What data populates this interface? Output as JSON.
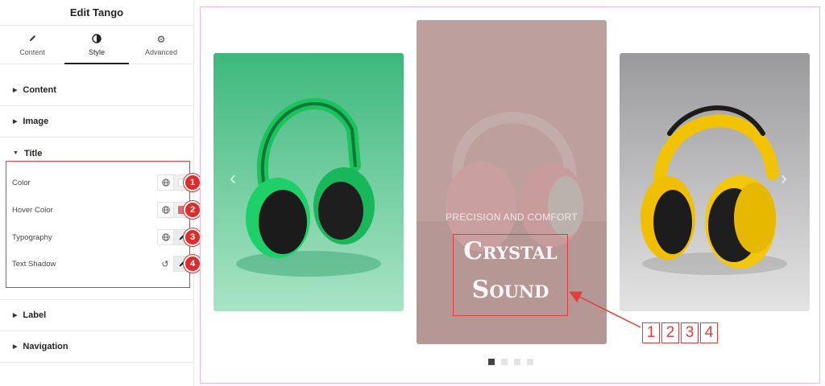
{
  "panel": {
    "title": "Edit Tango",
    "tabs": [
      {
        "label": "Content",
        "icon": "pencil-icon",
        "active": false
      },
      {
        "label": "Style",
        "icon": "contrast-icon",
        "active": true
      },
      {
        "label": "Advanced",
        "icon": "gear-icon",
        "active": false
      }
    ],
    "sections": {
      "content": "Content",
      "image": "Image",
      "title": "Title",
      "label": "Label",
      "navigation": "Navigation"
    },
    "controls": [
      {
        "label": "Color",
        "badge": "1",
        "swatch": "#ffffff"
      },
      {
        "label": "Hover Color",
        "badge": "2",
        "swatch": "#e26a6a"
      },
      {
        "label": "Typography",
        "badge": "3"
      },
      {
        "label": "Text Shadow",
        "badge": "4"
      }
    ]
  },
  "preview": {
    "active_slide": {
      "subtitle": "PRECISION AND COMFORT",
      "title_line1": "Crystal",
      "title_line2": "Sound"
    },
    "dots_count": 4,
    "active_dot": 1,
    "sequence_labels": [
      "1",
      "2",
      "3",
      "4"
    ],
    "colors": {
      "accent_red": "#e23d3d",
      "green_bg": "#3fbf7f",
      "yellow_bg": "#a9a9ab",
      "pink_bg": "#c9a9a7"
    }
  }
}
